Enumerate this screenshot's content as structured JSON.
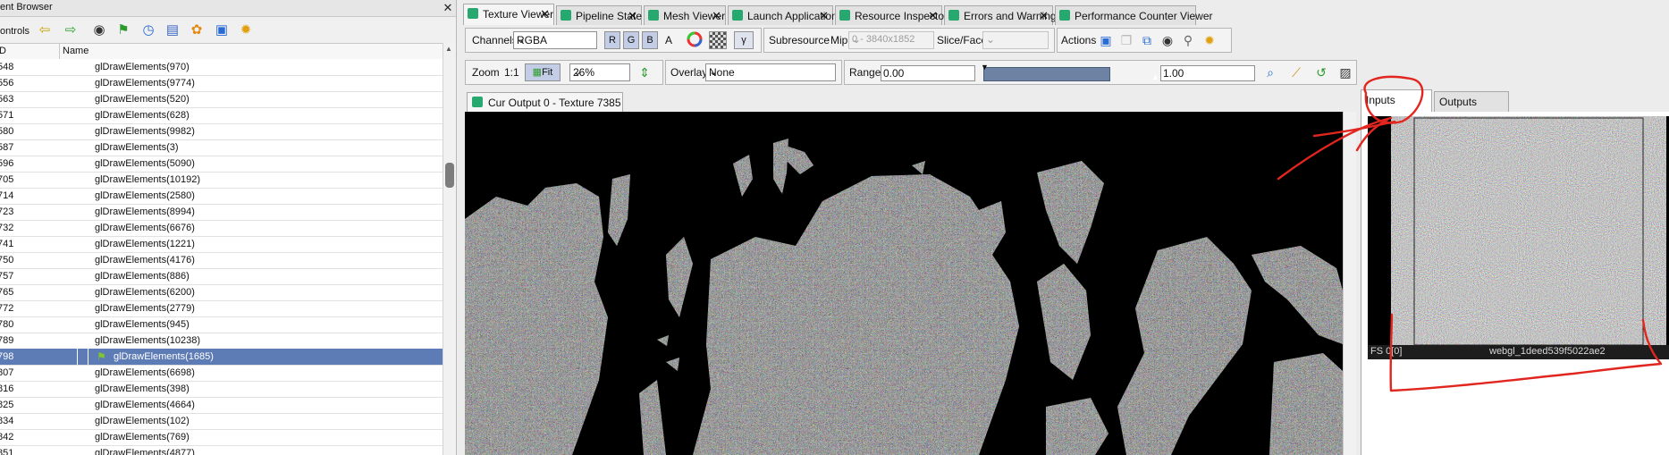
{
  "event_browser": {
    "title": "ent Browser",
    "controls_label": "ontrols",
    "columns": {
      "eid": "D",
      "name": "Name"
    },
    "rows": [
      {
        "eid": "548",
        "name": "glDrawElements(970)"
      },
      {
        "eid": "556",
        "name": "glDrawElements(9774)"
      },
      {
        "eid": "563",
        "name": "glDrawElements(520)"
      },
      {
        "eid": "571",
        "name": "glDrawElements(628)"
      },
      {
        "eid": "580",
        "name": "glDrawElements(9982)"
      },
      {
        "eid": "587",
        "name": "glDrawElements(3)"
      },
      {
        "eid": "596",
        "name": "glDrawElements(5090)"
      },
      {
        "eid": "705",
        "name": "glDrawElements(10192)"
      },
      {
        "eid": "714",
        "name": "glDrawElements(2580)"
      },
      {
        "eid": "723",
        "name": "glDrawElements(8994)"
      },
      {
        "eid": "732",
        "name": "glDrawElements(6676)"
      },
      {
        "eid": "741",
        "name": "glDrawElements(1221)"
      },
      {
        "eid": "750",
        "name": "glDrawElements(4176)"
      },
      {
        "eid": "757",
        "name": "glDrawElements(886)"
      },
      {
        "eid": "765",
        "name": "glDrawElements(6200)"
      },
      {
        "eid": "772",
        "name": "glDrawElements(2779)"
      },
      {
        "eid": "780",
        "name": "glDrawElements(945)"
      },
      {
        "eid": "789",
        "name": "glDrawElements(10238)"
      },
      {
        "eid": "798",
        "name": "glDrawElements(1685)"
      },
      {
        "eid": "807",
        "name": "glDrawElements(6698)"
      },
      {
        "eid": "816",
        "name": "glDrawElements(398)"
      },
      {
        "eid": "825",
        "name": "glDrawElements(4664)"
      },
      {
        "eid": "834",
        "name": "glDrawElements(102)"
      },
      {
        "eid": "842",
        "name": "glDrawElements(769)"
      },
      {
        "eid": "851",
        "name": "glDrawElements(4877)"
      }
    ],
    "selected_row": "798"
  },
  "tabs": [
    "Texture Viewer",
    "Pipeline State",
    "Mesh Viewer",
    "Launch Application",
    "Resource Inspector",
    "Errors and Warnings",
    "Performance Counter Viewer"
  ],
  "toolbar": {
    "channels_label": "Channels",
    "channels_value": "RGBA",
    "r": "R",
    "g": "G",
    "b": "B",
    "a": "A",
    "gamma": "γ",
    "subresource_label": "Subresource",
    "mip_label": "Mip",
    "mip_value": "0 - 3840x1852",
    "slice_label": "Slice/Face",
    "slice_value": "",
    "actions_label": "Actions",
    "zoom_label": "Zoom",
    "zoom_1to1": "1:1",
    "fit_label": "Fit",
    "zoom_value": "26%",
    "overlay_label": "Overlay",
    "overlay_value": "None",
    "range_label": "Range",
    "range_min": "0.00",
    "range_max": "1.00"
  },
  "output_tab_title": "Cur Output 0 - Texture 7385",
  "right_panel": {
    "inputs_tab": "Inputs",
    "outputs_tab": "Outputs",
    "thumb_slot": "FS 0[0]",
    "thumb_name": "webgl_1deed539f5022ae2"
  },
  "colors": {
    "selection": "#5d7bb5",
    "annotation": "#e0261e",
    "accent": "#27a86e"
  }
}
